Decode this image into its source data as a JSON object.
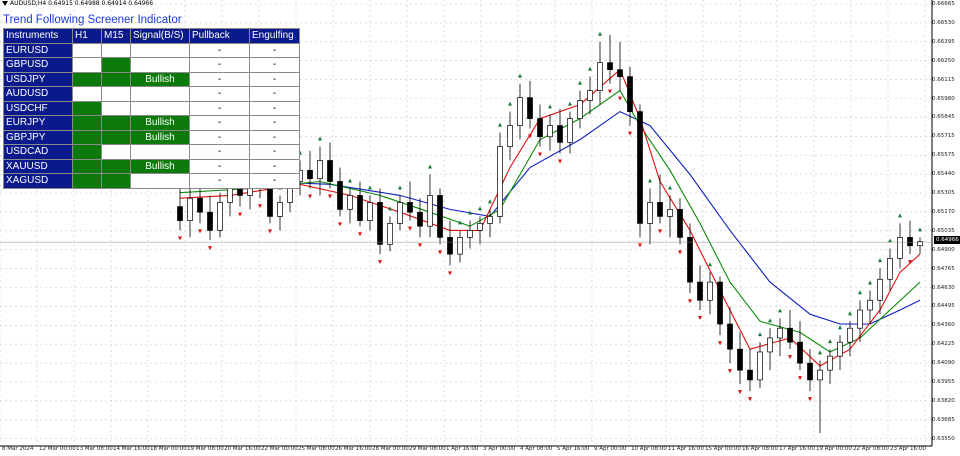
{
  "header": {
    "symbol_info": "AUDUSD,H4  0.64915 0.64988 0.64914 0.64966"
  },
  "screener": {
    "title": "Trend Following Screener Indicator",
    "columns": [
      "Instruments",
      "H1",
      "M15",
      "Signal(B/S)",
      "Pullback",
      "Engulfing"
    ],
    "rows": [
      {
        "symbol": "EURUSD",
        "h1": "white",
        "m15": "white",
        "signal": "",
        "signal_color": "white",
        "pullback": "-",
        "engulfing": "-"
      },
      {
        "symbol": "GBPUSD",
        "h1": "white",
        "m15": "green",
        "signal": "",
        "signal_color": "white",
        "pullback": "-",
        "engulfing": "-"
      },
      {
        "symbol": "USDJPY",
        "h1": "green",
        "m15": "green",
        "signal": "Bullish",
        "signal_color": "green",
        "pullback": "-",
        "engulfing": "-"
      },
      {
        "symbol": "AUDUSD",
        "h1": "white",
        "m15": "white",
        "signal": "",
        "signal_color": "white",
        "pullback": "-",
        "engulfing": "-"
      },
      {
        "symbol": "USDCHF",
        "h1": "green",
        "m15": "white",
        "signal": "",
        "signal_color": "white",
        "pullback": "-",
        "engulfing": "-"
      },
      {
        "symbol": "EURJPY",
        "h1": "green",
        "m15": "green",
        "signal": "Bullish",
        "signal_color": "green",
        "pullback": "-",
        "engulfing": "-"
      },
      {
        "symbol": "GBPJPY",
        "h1": "green",
        "m15": "green",
        "signal": "Bullish",
        "signal_color": "green",
        "pullback": "-",
        "engulfing": "-"
      },
      {
        "symbol": "USDCAD",
        "h1": "green",
        "m15": "white",
        "signal": "",
        "signal_color": "white",
        "pullback": "-",
        "engulfing": "-"
      },
      {
        "symbol": "XAUUSD",
        "h1": "green",
        "m15": "green",
        "signal": "Bullish",
        "signal_color": "green",
        "pullback": "-",
        "engulfing": "-"
      },
      {
        "symbol": "XAGUSD",
        "h1": "green",
        "m15": "green",
        "signal": "",
        "signal_color": "white",
        "pullback": "-",
        "engulfing": "-"
      }
    ]
  },
  "price_axis": {
    "ticks": [
      "0.66665",
      "0.66530",
      "0.66395",
      "0.66250",
      "0.66115",
      "0.65980",
      "0.65845",
      "0.65715",
      "0.65575",
      "0.65440",
      "0.65305",
      "0.65170",
      "0.65035",
      "0.64900",
      "0.64765",
      "0.64630",
      "0.64495",
      "0.64360",
      "0.64225",
      "0.64090",
      "0.63955",
      "0.63820",
      "0.63685",
      "0.63550"
    ],
    "current_price": "0.64966"
  },
  "time_axis": {
    "labels": [
      "8 Mar 2024",
      "12 Mar 00:00",
      "13 Mar 08:00",
      "14 Mar 16:00",
      "18 Mar 00:00",
      "19 Mar 08:00",
      "20 Mar 16:00",
      "22 Mar 00:00",
      "25 Mar 08:00",
      "26 Mar 16:00",
      "28 Mar 00:00",
      "29 Mar 08:00",
      "1 Apr 16:00",
      "3 Apr 00:00",
      "4 Apr 08:00",
      "5 Apr 16:00",
      "9 Apr 00:00",
      "10 Apr 08:00",
      "11 Apr 16:00",
      "15 Apr 00:00",
      "16 Apr 08:00",
      "17 Apr 16:00",
      "19 Apr 00:00",
      "22 Apr 08:00",
      "23 Apr 16:00"
    ]
  },
  "colors": {
    "table_header": "#0a1a8c",
    "signal_green": "#0b7a0b",
    "ma_fast": "#e01010",
    "ma_mid": "#0a8a0a",
    "ma_slow": "#1020c0",
    "arrow_up": "#1a7a3a",
    "arrow_down": "#e01010"
  },
  "chart_data": {
    "type": "candlestick",
    "symbol": "AUDUSD",
    "timeframe": "H4",
    "ylim": [
      0.6355,
      0.6667
    ],
    "candles": [
      {
        "x": 180,
        "o": 0.6522,
        "h": 0.654,
        "l": 0.6505,
        "c": 0.6512
      },
      {
        "x": 190,
        "o": 0.6512,
        "h": 0.6535,
        "l": 0.65,
        "c": 0.6528
      },
      {
        "x": 200,
        "o": 0.6528,
        "h": 0.6545,
        "l": 0.651,
        "c": 0.6518
      },
      {
        "x": 210,
        "o": 0.6518,
        "h": 0.653,
        "l": 0.6498,
        "c": 0.6505
      },
      {
        "x": 220,
        "o": 0.6505,
        "h": 0.6532,
        "l": 0.65,
        "c": 0.6525
      },
      {
        "x": 230,
        "o": 0.6525,
        "h": 0.655,
        "l": 0.6515,
        "c": 0.654
      },
      {
        "x": 240,
        "o": 0.654,
        "h": 0.6552,
        "l": 0.6522,
        "c": 0.653
      },
      {
        "x": 250,
        "o": 0.653,
        "h": 0.6545,
        "l": 0.652,
        "c": 0.654
      },
      {
        "x": 260,
        "o": 0.654,
        "h": 0.6552,
        "l": 0.6528,
        "c": 0.6535
      },
      {
        "x": 270,
        "o": 0.6535,
        "h": 0.654,
        "l": 0.651,
        "c": 0.6515
      },
      {
        "x": 280,
        "o": 0.6515,
        "h": 0.653,
        "l": 0.6505,
        "c": 0.6525
      },
      {
        "x": 290,
        "o": 0.6525,
        "h": 0.6545,
        "l": 0.6518,
        "c": 0.654
      },
      {
        "x": 300,
        "o": 0.654,
        "h": 0.6555,
        "l": 0.653,
        "c": 0.6548
      },
      {
        "x": 310,
        "o": 0.6548,
        "h": 0.6562,
        "l": 0.6535,
        "c": 0.6542
      },
      {
        "x": 320,
        "o": 0.6542,
        "h": 0.6565,
        "l": 0.653,
        "c": 0.6555
      },
      {
        "x": 330,
        "o": 0.6555,
        "h": 0.6568,
        "l": 0.6535,
        "c": 0.654
      },
      {
        "x": 340,
        "o": 0.654,
        "h": 0.655,
        "l": 0.6515,
        "c": 0.652
      },
      {
        "x": 350,
        "o": 0.652,
        "h": 0.6535,
        "l": 0.651,
        "c": 0.653
      },
      {
        "x": 360,
        "o": 0.653,
        "h": 0.654,
        "l": 0.6508,
        "c": 0.6512
      },
      {
        "x": 370,
        "o": 0.6512,
        "h": 0.653,
        "l": 0.6505,
        "c": 0.6525
      },
      {
        "x": 380,
        "o": 0.6525,
        "h": 0.6535,
        "l": 0.6488,
        "c": 0.6495
      },
      {
        "x": 390,
        "o": 0.6495,
        "h": 0.6515,
        "l": 0.649,
        "c": 0.651
      },
      {
        "x": 400,
        "o": 0.651,
        "h": 0.653,
        "l": 0.6505,
        "c": 0.6525
      },
      {
        "x": 410,
        "o": 0.6525,
        "h": 0.654,
        "l": 0.6512,
        "c": 0.6518
      },
      {
        "x": 420,
        "o": 0.6518,
        "h": 0.6528,
        "l": 0.65,
        "c": 0.6508
      },
      {
        "x": 430,
        "o": 0.6508,
        "h": 0.6545,
        "l": 0.65,
        "c": 0.653
      },
      {
        "x": 440,
        "o": 0.653,
        "h": 0.6535,
        "l": 0.6495,
        "c": 0.65
      },
      {
        "x": 450,
        "o": 0.65,
        "h": 0.6512,
        "l": 0.648,
        "c": 0.6488
      },
      {
        "x": 460,
        "o": 0.6488,
        "h": 0.6505,
        "l": 0.6482,
        "c": 0.65
      },
      {
        "x": 470,
        "o": 0.65,
        "h": 0.6512,
        "l": 0.6492,
        "c": 0.6505
      },
      {
        "x": 480,
        "o": 0.6505,
        "h": 0.6515,
        "l": 0.6495,
        "c": 0.651
      },
      {
        "x": 490,
        "o": 0.651,
        "h": 0.652,
        "l": 0.65,
        "c": 0.6515
      },
      {
        "x": 500,
        "o": 0.6515,
        "h": 0.6575,
        "l": 0.651,
        "c": 0.6565
      },
      {
        "x": 510,
        "o": 0.6565,
        "h": 0.659,
        "l": 0.6555,
        "c": 0.658
      },
      {
        "x": 520,
        "o": 0.658,
        "h": 0.661,
        "l": 0.657,
        "c": 0.66
      },
      {
        "x": 530,
        "o": 0.66,
        "h": 0.6612,
        "l": 0.6578,
        "c": 0.6585
      },
      {
        "x": 540,
        "o": 0.6585,
        "h": 0.6595,
        "l": 0.6565,
        "c": 0.6572
      },
      {
        "x": 550,
        "o": 0.6572,
        "h": 0.6588,
        "l": 0.6562,
        "c": 0.658
      },
      {
        "x": 560,
        "o": 0.658,
        "h": 0.6592,
        "l": 0.656,
        "c": 0.6568
      },
      {
        "x": 570,
        "o": 0.6568,
        "h": 0.659,
        "l": 0.656,
        "c": 0.6585
      },
      {
        "x": 580,
        "o": 0.6585,
        "h": 0.6605,
        "l": 0.6578,
        "c": 0.6598
      },
      {
        "x": 590,
        "o": 0.6598,
        "h": 0.6615,
        "l": 0.6588,
        "c": 0.6605
      },
      {
        "x": 600,
        "o": 0.6605,
        "h": 0.664,
        "l": 0.6595,
        "c": 0.6625
      },
      {
        "x": 610,
        "o": 0.6625,
        "h": 0.6645,
        "l": 0.661,
        "c": 0.662
      },
      {
        "x": 620,
        "o": 0.662,
        "h": 0.664,
        "l": 0.6605,
        "c": 0.6615
      },
      {
        "x": 630,
        "o": 0.6615,
        "h": 0.6622,
        "l": 0.658,
        "c": 0.659
      },
      {
        "x": 640,
        "o": 0.659,
        "h": 0.6595,
        "l": 0.65,
        "c": 0.651
      },
      {
        "x": 650,
        "o": 0.651,
        "h": 0.6535,
        "l": 0.6495,
        "c": 0.6525
      },
      {
        "x": 660,
        "o": 0.6525,
        "h": 0.6545,
        "l": 0.651,
        "c": 0.6515
      },
      {
        "x": 670,
        "o": 0.6515,
        "h": 0.653,
        "l": 0.65,
        "c": 0.652
      },
      {
        "x": 680,
        "o": 0.652,
        "h": 0.6528,
        "l": 0.6495,
        "c": 0.65
      },
      {
        "x": 690,
        "o": 0.65,
        "h": 0.651,
        "l": 0.646,
        "c": 0.6468
      },
      {
        "x": 700,
        "o": 0.6468,
        "h": 0.648,
        "l": 0.6448,
        "c": 0.6455
      },
      {
        "x": 710,
        "o": 0.6455,
        "h": 0.6475,
        "l": 0.6445,
        "c": 0.6468
      },
      {
        "x": 720,
        "o": 0.6468,
        "h": 0.6472,
        "l": 0.643,
        "c": 0.6438
      },
      {
        "x": 730,
        "o": 0.6438,
        "h": 0.645,
        "l": 0.641,
        "c": 0.642
      },
      {
        "x": 740,
        "o": 0.642,
        "h": 0.6432,
        "l": 0.6395,
        "c": 0.6405
      },
      {
        "x": 750,
        "o": 0.6405,
        "h": 0.642,
        "l": 0.639,
        "c": 0.6398
      },
      {
        "x": 760,
        "o": 0.6398,
        "h": 0.6425,
        "l": 0.6392,
        "c": 0.6418
      },
      {
        "x": 770,
        "o": 0.6418,
        "h": 0.6435,
        "l": 0.6405,
        "c": 0.6428
      },
      {
        "x": 780,
        "o": 0.6428,
        "h": 0.6442,
        "l": 0.6415,
        "c": 0.6435
      },
      {
        "x": 790,
        "o": 0.6435,
        "h": 0.6448,
        "l": 0.642,
        "c": 0.6425
      },
      {
        "x": 800,
        "o": 0.6425,
        "h": 0.644,
        "l": 0.6405,
        "c": 0.641
      },
      {
        "x": 810,
        "o": 0.641,
        "h": 0.642,
        "l": 0.639,
        "c": 0.6398
      },
      {
        "x": 820,
        "o": 0.6398,
        "h": 0.6412,
        "l": 0.636,
        "c": 0.6405
      },
      {
        "x": 830,
        "o": 0.6405,
        "h": 0.642,
        "l": 0.6395,
        "c": 0.6415
      },
      {
        "x": 840,
        "o": 0.6415,
        "h": 0.643,
        "l": 0.6405,
        "c": 0.6425
      },
      {
        "x": 850,
        "o": 0.6425,
        "h": 0.644,
        "l": 0.6415,
        "c": 0.6435
      },
      {
        "x": 860,
        "o": 0.6435,
        "h": 0.6455,
        "l": 0.6425,
        "c": 0.6448
      },
      {
        "x": 870,
        "o": 0.6448,
        "h": 0.6462,
        "l": 0.6438,
        "c": 0.6455
      },
      {
        "x": 880,
        "o": 0.6455,
        "h": 0.6478,
        "l": 0.6445,
        "c": 0.647
      },
      {
        "x": 890,
        "o": 0.647,
        "h": 0.6492,
        "l": 0.6462,
        "c": 0.6485
      },
      {
        "x": 900,
        "o": 0.6485,
        "h": 0.651,
        "l": 0.6478,
        "c": 0.65
      },
      {
        "x": 910,
        "o": 0.65,
        "h": 0.6512,
        "l": 0.6488,
        "c": 0.6494
      },
      {
        "x": 920,
        "o": 0.6494,
        "h": 0.65,
        "l": 0.6488,
        "c": 0.6497
      }
    ],
    "ma_fast": [
      [
        180,
        0.6528
      ],
      [
        230,
        0.653
      ],
      [
        300,
        0.6538
      ],
      [
        350,
        0.653
      ],
      [
        400,
        0.6518
      ],
      [
        450,
        0.6505
      ],
      [
        480,
        0.6505
      ],
      [
        510,
        0.655
      ],
      [
        540,
        0.6585
      ],
      [
        580,
        0.6595
      ],
      [
        620,
        0.662
      ],
      [
        640,
        0.6585
      ],
      [
        660,
        0.654
      ],
      [
        690,
        0.6505
      ],
      [
        720,
        0.6462
      ],
      [
        750,
        0.642
      ],
      [
        790,
        0.6428
      ],
      [
        820,
        0.6408
      ],
      [
        850,
        0.642
      ],
      [
        880,
        0.6448
      ],
      [
        900,
        0.6475
      ],
      [
        920,
        0.6488
      ]
    ],
    "ma_mid": [
      [
        180,
        0.6532
      ],
      [
        250,
        0.6535
      ],
      [
        320,
        0.654
      ],
      [
        380,
        0.653
      ],
      [
        430,
        0.6518
      ],
      [
        470,
        0.6508
      ],
      [
        500,
        0.652
      ],
      [
        540,
        0.657
      ],
      [
        580,
        0.6585
      ],
      [
        620,
        0.6605
      ],
      [
        640,
        0.658
      ],
      [
        670,
        0.6548
      ],
      [
        700,
        0.651
      ],
      [
        730,
        0.6468
      ],
      [
        760,
        0.644
      ],
      [
        800,
        0.6432
      ],
      [
        830,
        0.6418
      ],
      [
        860,
        0.6428
      ],
      [
        890,
        0.6448
      ],
      [
        920,
        0.6468
      ]
    ],
    "ma_slow": [
      [
        180,
        0.654
      ],
      [
        260,
        0.654
      ],
      [
        330,
        0.6538
      ],
      [
        400,
        0.653
      ],
      [
        450,
        0.652
      ],
      [
        490,
        0.6515
      ],
      [
        530,
        0.655
      ],
      [
        580,
        0.657
      ],
      [
        620,
        0.659
      ],
      [
        650,
        0.658
      ],
      [
        690,
        0.6545
      ],
      [
        730,
        0.6505
      ],
      [
        770,
        0.6468
      ],
      [
        810,
        0.6445
      ],
      [
        840,
        0.6438
      ],
      [
        870,
        0.6438
      ],
      [
        900,
        0.6448
      ],
      [
        920,
        0.6455
      ]
    ]
  }
}
